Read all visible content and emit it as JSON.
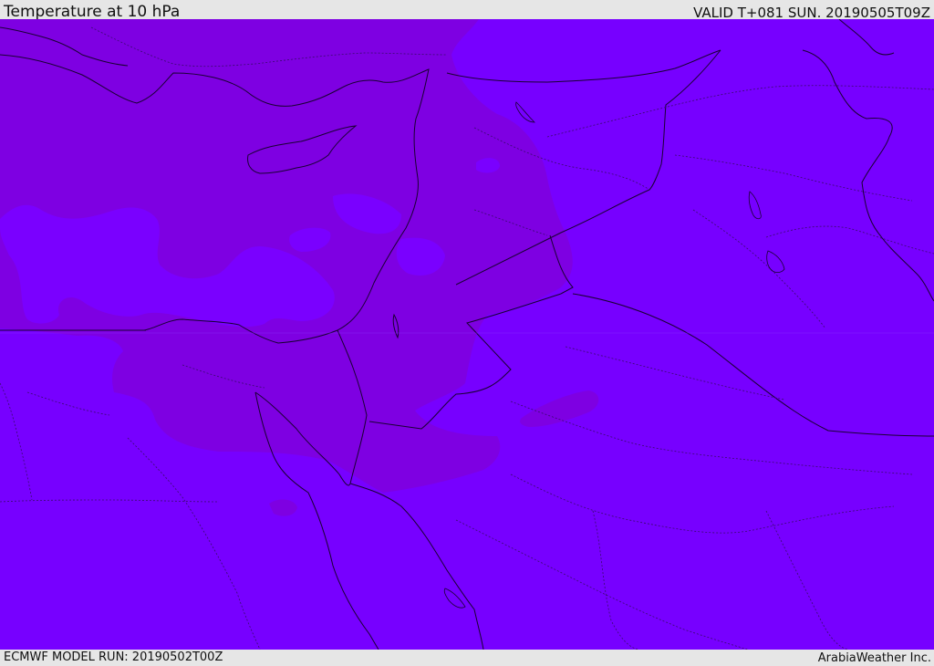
{
  "header": {
    "title": "Temperature at 10 hPa",
    "valid": "VALID T+081 SUN. 20190505T09Z"
  },
  "footer": {
    "model_run": "ECMWF MODEL RUN: 20190502T00Z",
    "credit": "ArabiaWeather Inc."
  },
  "map": {
    "colors": {
      "base": "#7700ff",
      "warm_band": "#7e00e2",
      "cool_patch": "#7a00ff",
      "coast_line": "#1a0033",
      "border_line": "#1a0033",
      "province_line": "#3b0a6e"
    }
  }
}
